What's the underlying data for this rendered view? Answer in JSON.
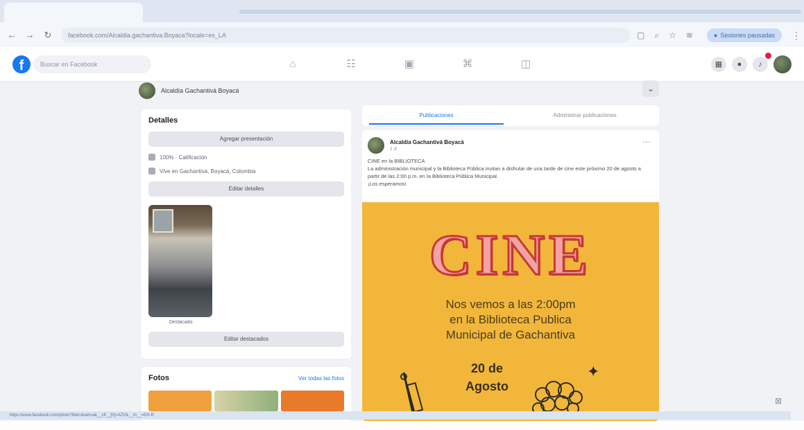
{
  "browser": {
    "url": "facebook.com/Alcaldia.gachantiva.Boyaca?locale=es_LA",
    "profile_label": "Sesiones pausadas"
  },
  "fb": {
    "logo": "f",
    "search_placeholder": "Buscar en Facebook"
  },
  "page": {
    "name": "Alcaldía Gachantivá Boyacá"
  },
  "details": {
    "title": "Detalles",
    "add_presentation": "Agregar presentación",
    "rating": "100% · Calificación",
    "location": "Vive en Gachantivá, Boyacá, Colombia",
    "edit_details": "Editar detalles",
    "featured_caption": "Destacado",
    "edit_featured": "Editar destacados"
  },
  "photos": {
    "title": "Fotos",
    "see_all": "Ver todas las fotos"
  },
  "tabs": {
    "comments": "Publicaciones",
    "manage": "Administrar publicaciones"
  },
  "post": {
    "author": "Alcaldía Gachantivá Boyacá",
    "time": "1 d",
    "line1": "CINE en la BIBLIOTECA",
    "line2": "La administración municipal y la Biblioteca Pública invitan a disfrutar de una tarde de cine este próximo 20 de agosto a partir de las 2:00 p.m. en la Biblioteca Pública Municipal.",
    "line3": "¡Los esperamos!",
    "poster_title": "CINE",
    "poster_line1": "Nos vemos a las 2:00pm",
    "poster_line2": "en la Biblioteca Publica",
    "poster_line3": "Municipal de Gachantiva",
    "poster_date1": "20 de",
    "poster_date2": "Agosto"
  },
  "status_url": "https://www.facebook.com/photo?fbid=&set=a&__cft__[0]=AZV&__tn__=EH-R"
}
